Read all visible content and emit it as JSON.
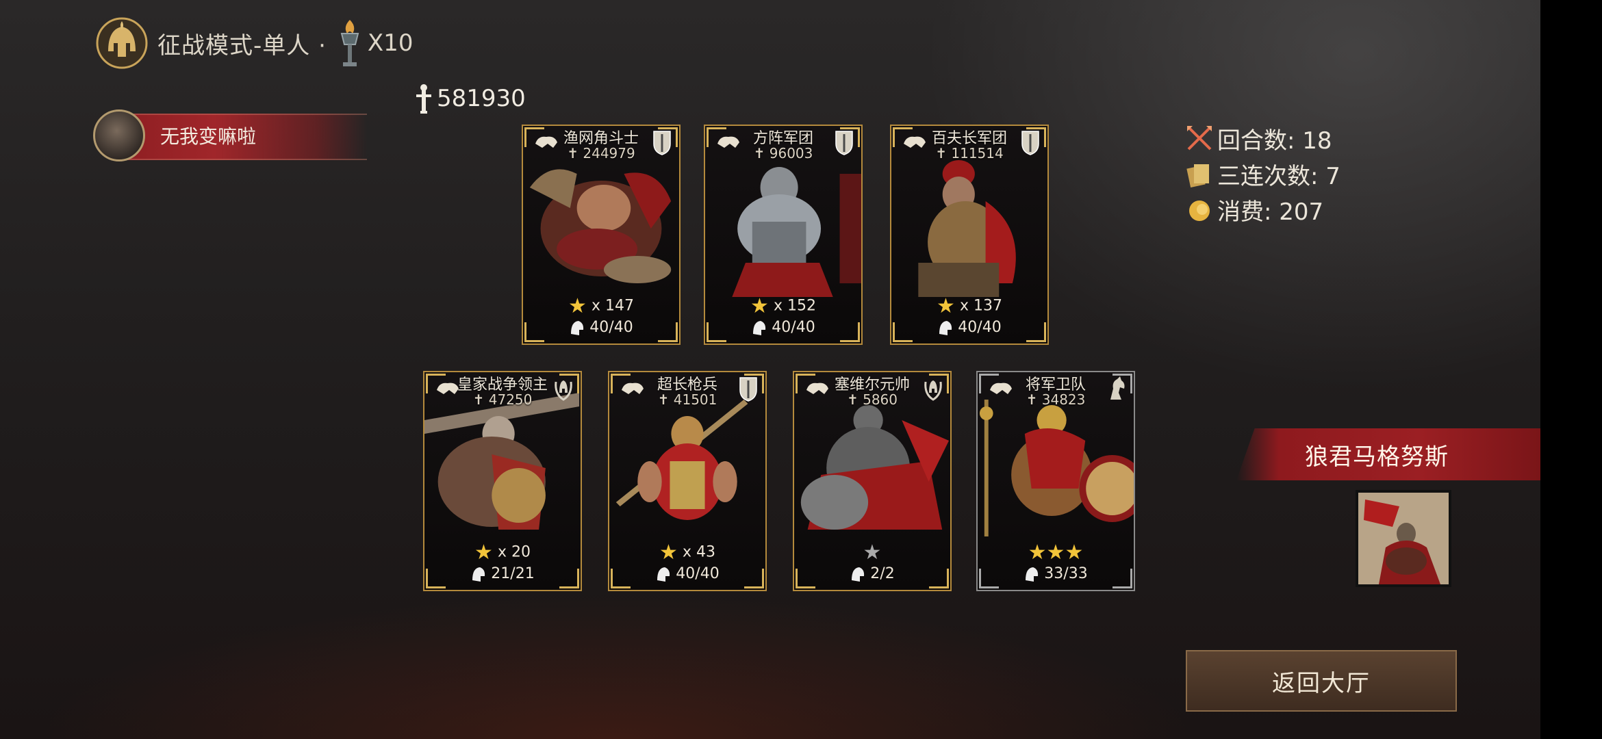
{
  "header": {
    "mode_title": "征战模式-单人 ·",
    "torch_count": "X10",
    "helmet_icon": "helmet-emblem-icon",
    "torch_icon": "torch-icon"
  },
  "player": {
    "name": "无我变嘛啦"
  },
  "total_power": "581930",
  "cards": [
    {
      "name": "渔网角斗士",
      "power": "244979",
      "type_icon": "shield-icon",
      "stars_text": "x 147",
      "troops": "40/40",
      "star_count": 1,
      "star_color": "gold"
    },
    {
      "name": "方阵军团",
      "power": "96003",
      "type_icon": "shield-icon",
      "stars_text": "x 152",
      "troops": "40/40",
      "star_count": 1,
      "star_color": "gold"
    },
    {
      "name": "百夫长军团",
      "power": "111514",
      "type_icon": "shield-icon",
      "stars_text": "x 137",
      "troops": "40/40",
      "star_count": 1,
      "star_color": "gold"
    },
    {
      "name": "皇家战争领主",
      "power": "47250",
      "type_icon": "laurel-helmet-icon",
      "stars_text": "x 20",
      "troops": "21/21",
      "star_count": 1,
      "star_color": "gold"
    },
    {
      "name": "超长枪兵",
      "power": "41501",
      "type_icon": "shield-icon",
      "stars_text": "x 43",
      "troops": "40/40",
      "star_count": 1,
      "star_color": "gold"
    },
    {
      "name": "塞维尔元帅",
      "power": "5860",
      "type_icon": "laurel-helmet-icon",
      "stars_text": "",
      "troops": "2/2",
      "star_count": 1,
      "star_color": "grey"
    },
    {
      "name": "将军卫队",
      "power": "34823",
      "type_icon": "horse-icon",
      "stars_text": "",
      "troops": "33/33",
      "star_count": 3,
      "star_color": "gold"
    }
  ],
  "stats": {
    "rounds": "回合数: 18",
    "triples": "三连次数: 7",
    "cost": "消费: 207"
  },
  "commander": {
    "name": "狼君马格努斯"
  },
  "return_button": {
    "label": "返回大厅"
  },
  "colors": {
    "accent_red": "#9b1f23",
    "gold_border": "#b48a3c",
    "star_gold": "#f2c43a"
  }
}
